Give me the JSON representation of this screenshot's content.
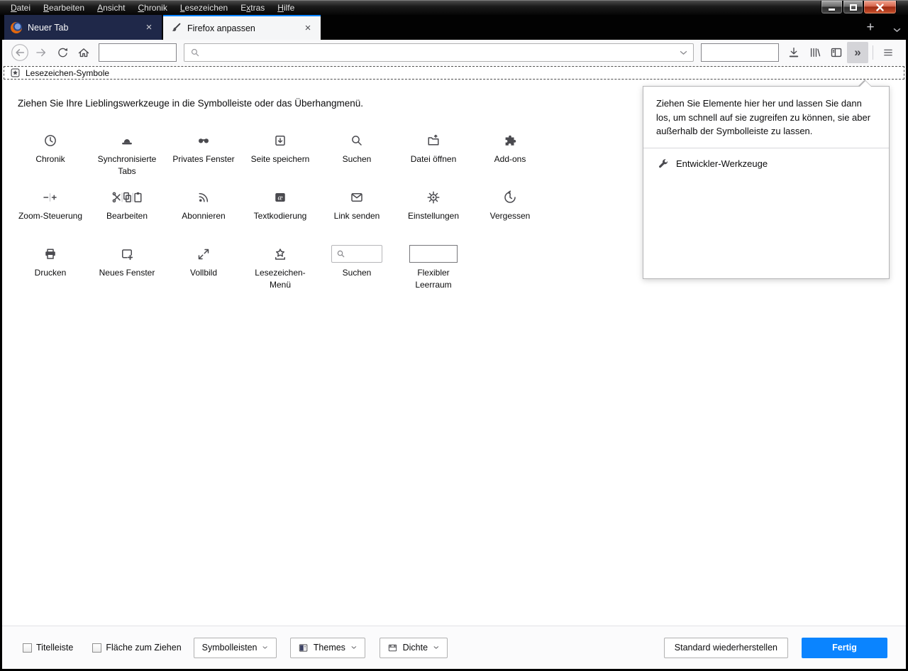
{
  "window": {
    "menu": [
      {
        "pre": "",
        "key": "D",
        "post": "atei"
      },
      {
        "pre": "",
        "key": "B",
        "post": "earbeiten"
      },
      {
        "pre": "",
        "key": "A",
        "post": "nsicht"
      },
      {
        "pre": "",
        "key": "C",
        "post": "hronik"
      },
      {
        "pre": "",
        "key": "L",
        "post": "esezeichen"
      },
      {
        "pre": "E",
        "key": "x",
        "post": "tras"
      },
      {
        "pre": "",
        "key": "H",
        "post": "ilfe"
      }
    ],
    "controls": [
      "minimize",
      "maximize",
      "close"
    ]
  },
  "tabs": {
    "items": [
      {
        "title": "Neuer Tab",
        "icon": "firefox-logo",
        "active": false
      },
      {
        "title": "Firefox anpassen",
        "icon": "paintbrush",
        "active": true
      }
    ],
    "new_tab_icon": "plus",
    "list_tabs_icon": "chevron-down"
  },
  "toolbar": {
    "icons": [
      "back",
      "forward",
      "reload",
      "home",
      "flexible-space",
      "address-bar-magnifier",
      "chevron-down",
      "flexible-space",
      "download",
      "library",
      "sidebar",
      "overflow-chevrons",
      "hamburger-menu"
    ]
  },
  "bookmarks_bar": {
    "icon": "bookmark-star-box",
    "label": "Lesezeichen-Symbole"
  },
  "customize": {
    "intro": "Ziehen Sie Ihre Lieblingswerkzeuge in die Symbolleiste oder das Überhangmenü.",
    "palette": [
      {
        "label": "Chronik",
        "icon": "clock"
      },
      {
        "label": "Synchronisierte Tabs",
        "icon": "synced-tabs"
      },
      {
        "label": "Privates Fenster",
        "icon": "private-mask"
      },
      {
        "label": "Seite speichern",
        "icon": "save-page"
      },
      {
        "label": "Suchen",
        "icon": "search"
      },
      {
        "label": "Datei öffnen",
        "icon": "open-file"
      },
      {
        "label": "Add-ons",
        "icon": "puzzle"
      },
      {
        "label": "Zoom-Steuerung",
        "icon": "zoom-minus-plus"
      },
      {
        "label": "Bearbeiten",
        "icon": "cut-copy-paste"
      },
      {
        "label": "Abonnieren",
        "icon": "rss"
      },
      {
        "label": "Textkodierung",
        "icon": "text-encoding"
      },
      {
        "label": "Link senden",
        "icon": "envelope"
      },
      {
        "label": "Einstellungen",
        "icon": "gear"
      },
      {
        "label": "Vergessen",
        "icon": "history-back-clock"
      },
      {
        "label": "Drucken",
        "icon": "printer"
      },
      {
        "label": "Neues Fenster",
        "icon": "new-window"
      },
      {
        "label": "Vollbild",
        "icon": "fullscreen-arrows"
      },
      {
        "label": "Lesezeichen-Menü",
        "icon": "bookmark-star-menu"
      },
      {
        "label": "Suchen",
        "icon": "search-field-widget"
      },
      {
        "label": "Flexibler Leerraum",
        "icon": "flexible-space-widget"
      }
    ],
    "overflow_panel": {
      "text": "Ziehen Sie Elemente hier her und lassen Sie dann los, um schnell auf sie zugreifen zu können, sie aber außerhalb der Symbolleiste zu lassen.",
      "items": [
        {
          "label": "Entwickler-Werkzeuge",
          "icon": "wrench"
        }
      ]
    }
  },
  "footer": {
    "checkboxes": [
      {
        "label": "Titelleiste",
        "checked": false
      },
      {
        "label": "Fläche zum Ziehen",
        "checked": false
      }
    ],
    "dropdowns": [
      {
        "label": "Symbolleisten",
        "icon": "none"
      },
      {
        "label": "Themes",
        "icon": "theme-preview"
      },
      {
        "label": "Dichte",
        "icon": "density"
      }
    ],
    "restore_button": "Standard wiederherstellen",
    "done_button": "Fertig"
  },
  "colors": {
    "accent": "#0a84ff",
    "dark_tab_bg": "#1f2849",
    "close_button_red": "#c14a28",
    "icon": "#4a4a4f"
  }
}
